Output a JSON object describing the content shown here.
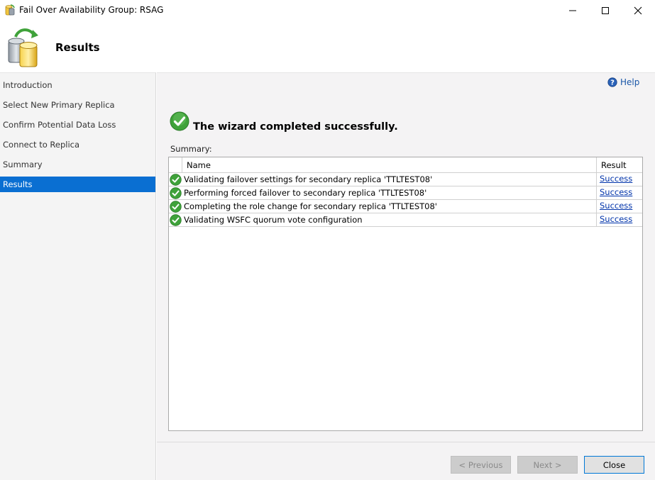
{
  "window": {
    "title": "Fail Over Availability Group: RSAG",
    "icon": "database-wizard-icon"
  },
  "header": {
    "title": "Results",
    "icon": "database-refresh-icon"
  },
  "nav": {
    "items": [
      {
        "label": "Introduction",
        "active": false
      },
      {
        "label": "Select New Primary Replica",
        "active": false
      },
      {
        "label": "Confirm Potential Data Loss",
        "active": false
      },
      {
        "label": "Connect to Replica",
        "active": false
      },
      {
        "label": "Summary",
        "active": false
      },
      {
        "label": "Results",
        "active": true
      }
    ]
  },
  "main": {
    "help_label": "Help",
    "status_text": "The wizard completed successfully.",
    "summary_label": "Summary:",
    "table": {
      "columns": [
        "Name",
        "Result"
      ],
      "rows": [
        {
          "name": "Validating failover settings for secondary replica 'TTLTEST08'",
          "result": "Success",
          "status_icon": "success-check-icon"
        },
        {
          "name": "Performing forced failover to secondary replica 'TTLTEST08'",
          "result": "Success",
          "status_icon": "success-check-icon"
        },
        {
          "name": "Completing the role change for secondary replica 'TTLTEST08'",
          "result": "Success",
          "status_icon": "success-check-icon"
        },
        {
          "name": "Validating WSFC quorum vote configuration",
          "result": "Success",
          "status_icon": "success-check-icon"
        }
      ]
    }
  },
  "buttons": {
    "previous": "< Previous",
    "next": "Next >",
    "close": "Close"
  },
  "colors": {
    "accent": "#0a6fd2",
    "success_green": "#3fa23a",
    "link": "#0033aa"
  }
}
